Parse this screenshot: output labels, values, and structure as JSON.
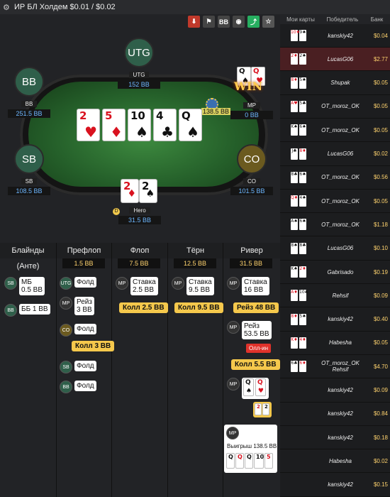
{
  "title": "ИР БЛ Холдем $0.01 / $0.02",
  "toolbar": {
    "bb": "BB"
  },
  "seats": {
    "utg": {
      "avatar": "UTG",
      "name": "UTG",
      "stack": "152 BB"
    },
    "bb": {
      "avatar": "BB",
      "name": "BB",
      "stack": "251.5 BB"
    },
    "mp": {
      "name": "MP",
      "stack": "0 BB"
    },
    "sb": {
      "avatar": "SB",
      "name": "SB",
      "stack": "108.5 BB"
    },
    "co": {
      "avatar": "CO",
      "name": "CO",
      "stack": "101.5 BB"
    },
    "hero": {
      "name": "Hero",
      "stack": "31.5 BB"
    }
  },
  "win_badge": "WIN",
  "pot_amount": "138.5 BB",
  "dealer_button": "D",
  "board": [
    {
      "rank": "2",
      "suit": "♥"
    },
    {
      "rank": "5",
      "suit": "♦"
    },
    {
      "rank": "10",
      "suit": "♠"
    },
    {
      "rank": "4",
      "suit": "♣"
    },
    {
      "rank": "Q",
      "suit": "♠"
    }
  ],
  "hero_cards": [
    {
      "rank": "2",
      "suit": "♦"
    },
    {
      "rank": "2",
      "suit": "♠"
    }
  ],
  "mp_cards": [
    {
      "rank": "Q",
      "suit": "♠"
    },
    {
      "rank": "Q",
      "suit": "♥"
    }
  ],
  "streets": {
    "blinds": {
      "label": "Блайнды (Анте)"
    },
    "preflop": {
      "label": "Префлоп",
      "pot": "1.5 BB"
    },
    "flop": {
      "label": "Флоп",
      "pot": "7.5 BB"
    },
    "turn": {
      "label": "Тёрн",
      "pot": "12.5 BB"
    },
    "river": {
      "label": "Ривер",
      "pot": "31.5 BB"
    }
  },
  "actions": {
    "sb_blind": {
      "pos": "SB",
      "text1": "МБ",
      "text2": "0.5 BB"
    },
    "bb_blind": {
      "pos": "BB",
      "text1": "ББ 1 BB"
    },
    "utg_fold": {
      "pos": "UTG",
      "text1": "Фолд"
    },
    "mp_raise": {
      "pos": "MP",
      "text1": "Рейз",
      "text2": "3 BB"
    },
    "co_fold": {
      "pos": "CO",
      "text1": "Фолд"
    },
    "hero_call_pre": "Колл 3 BB",
    "sb_fold": {
      "pos": "SB",
      "text1": "Фолд"
    },
    "bb_fold": {
      "pos": "BB",
      "text1": "Фолд"
    },
    "mp_bet_flop": {
      "pos": "MP",
      "text1": "Ставка",
      "text2": "2.5 BB"
    },
    "hero_call_flop": "Колл 2.5 BB",
    "mp_bet_turn": {
      "pos": "MP",
      "text1": "Ставка",
      "text2": "9.5 BB"
    },
    "hero_call_turn": "Колл 9.5 BB",
    "mp_bet_river": {
      "pos": "MP",
      "text1": "Ставка",
      "text2": "16 BB"
    },
    "hero_raise_river": "Рейз 48 BB",
    "mp_reraise": {
      "pos": "MP",
      "text1": "Рейз",
      "text2": "53.5 BB"
    },
    "allin": "Олл-ин",
    "hero_call_river": "Колл 5.5 BB",
    "mp_show": {
      "pos": "MP"
    },
    "winner": {
      "pos": "MP",
      "text": "Выигрыш 138.5 BB"
    }
  },
  "history_header": {
    "my_cards": "Мои карты",
    "winner": "Победитель",
    "bank": "Банк"
  },
  "history": [
    {
      "c1": "10♦",
      "c2": "9♠",
      "winner": "kanskiy42",
      "bank": "$0.04"
    },
    {
      "c1": "2♦",
      "c2": "2♠",
      "winner": "LucasG06",
      "bank": "$2.77"
    },
    {
      "c1": "8♦",
      "c2": "5♠",
      "winner": "Shupak",
      "bank": "$0.05"
    },
    {
      "c1": "A♥",
      "c2": "5♣",
      "winner": "OT_moroz_OK",
      "bank": "$0.05"
    },
    {
      "c1": "K♠",
      "c2": "6♠",
      "winner": "OT_moroz_OK",
      "bank": "$0.05"
    },
    {
      "c1": "J♣",
      "c2": "8♦",
      "winner": "LucasG06",
      "bank": "$0.02"
    },
    {
      "c1": "8♣",
      "c2": "6♠",
      "winner": "OT_moroz_OK",
      "bank": "$0.56"
    },
    {
      "c1": "Q♦",
      "c2": "4♠",
      "winner": "OT_moroz_OK",
      "bank": "$0.05"
    },
    {
      "c1": "A♠",
      "c2": "6♠",
      "winner": "OT_moroz_OK",
      "bank": "$1.18"
    },
    {
      "c1": "8♠",
      "c2": "8♣",
      "winner": "LucasG06",
      "bank": "$0.10"
    },
    {
      "c1": "K♠",
      "c2": "2♦",
      "winner": "Gabrisado",
      "bank": "$0.19"
    },
    {
      "c1": "A♦",
      "c2": "10♣",
      "winner": "Rehsif",
      "bank": "$0.09"
    },
    {
      "c1": "8♦",
      "c2": "5♠",
      "winner": "kanskiy42",
      "bank": "$0.40"
    },
    {
      "c1": "K♦",
      "c2": "4♦",
      "winner": "Habesha",
      "bank": "$0.05"
    },
    {
      "c1": "6♣",
      "c2": "6♦",
      "winner": "OT_moroz_OK",
      "winner2": "Rehsif",
      "bank": "$4.70"
    },
    {
      "c1": "",
      "c2": "",
      "winner": "kanskiy42",
      "bank": "$0.09"
    },
    {
      "c1": "",
      "c2": "",
      "winner": "kanskiy42",
      "bank": "$0.84"
    },
    {
      "c1": "",
      "c2": "",
      "winner": "kanskiy42",
      "bank": "$0.18"
    },
    {
      "c1": "",
      "c2": "",
      "winner": "Habesha",
      "bank": "$0.02"
    },
    {
      "c1": "",
      "c2": "",
      "winner": "kanskiy42",
      "bank": "$0.15"
    }
  ],
  "colors": {
    "yellow": "#f5c84c",
    "red": "#d9121f",
    "accent": "#ffd36e"
  }
}
